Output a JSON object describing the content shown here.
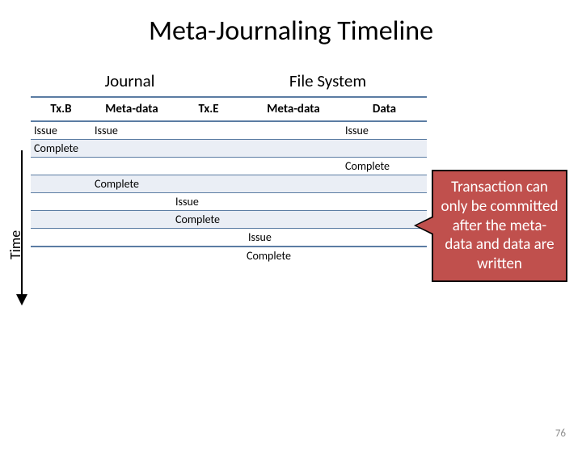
{
  "title": "Meta-Journaling Timeline",
  "groups": {
    "g1": "Journal",
    "g2": "File System"
  },
  "columns": {
    "c1": "Tx.B",
    "c2": "Meta-data",
    "c3": "Tx.E",
    "c4": "Meta-data",
    "c5": "Data"
  },
  "rows": [
    {
      "c1": "Issue",
      "c2": "Issue",
      "c3": "",
      "c4": "",
      "c5": "Issue",
      "shade": false
    },
    {
      "c1": "Complete",
      "c2": "",
      "c3": "",
      "c4": "",
      "c5": "",
      "shade": true
    },
    {
      "c1": "",
      "c2": "",
      "c3": "",
      "c4": "",
      "c5": "Complete",
      "shade": false
    },
    {
      "c1": "",
      "c2": "Complete",
      "c3": "",
      "c4": "",
      "c5": "",
      "shade": true
    },
    {
      "c1": "",
      "c2": "",
      "c3": "Issue",
      "c4": "",
      "c5": "",
      "shade": false
    },
    {
      "c1": "",
      "c2": "",
      "c3": "Complete",
      "c4": "",
      "c5": "",
      "shade": true
    },
    {
      "c1": "",
      "c2": "",
      "c3": "",
      "c4": "Issue",
      "c5": "",
      "shade": false
    }
  ],
  "extra": "Complete",
  "axis_label": "Time",
  "callout": "Transaction can only be committed after the meta-data and data are written",
  "page": "76"
}
